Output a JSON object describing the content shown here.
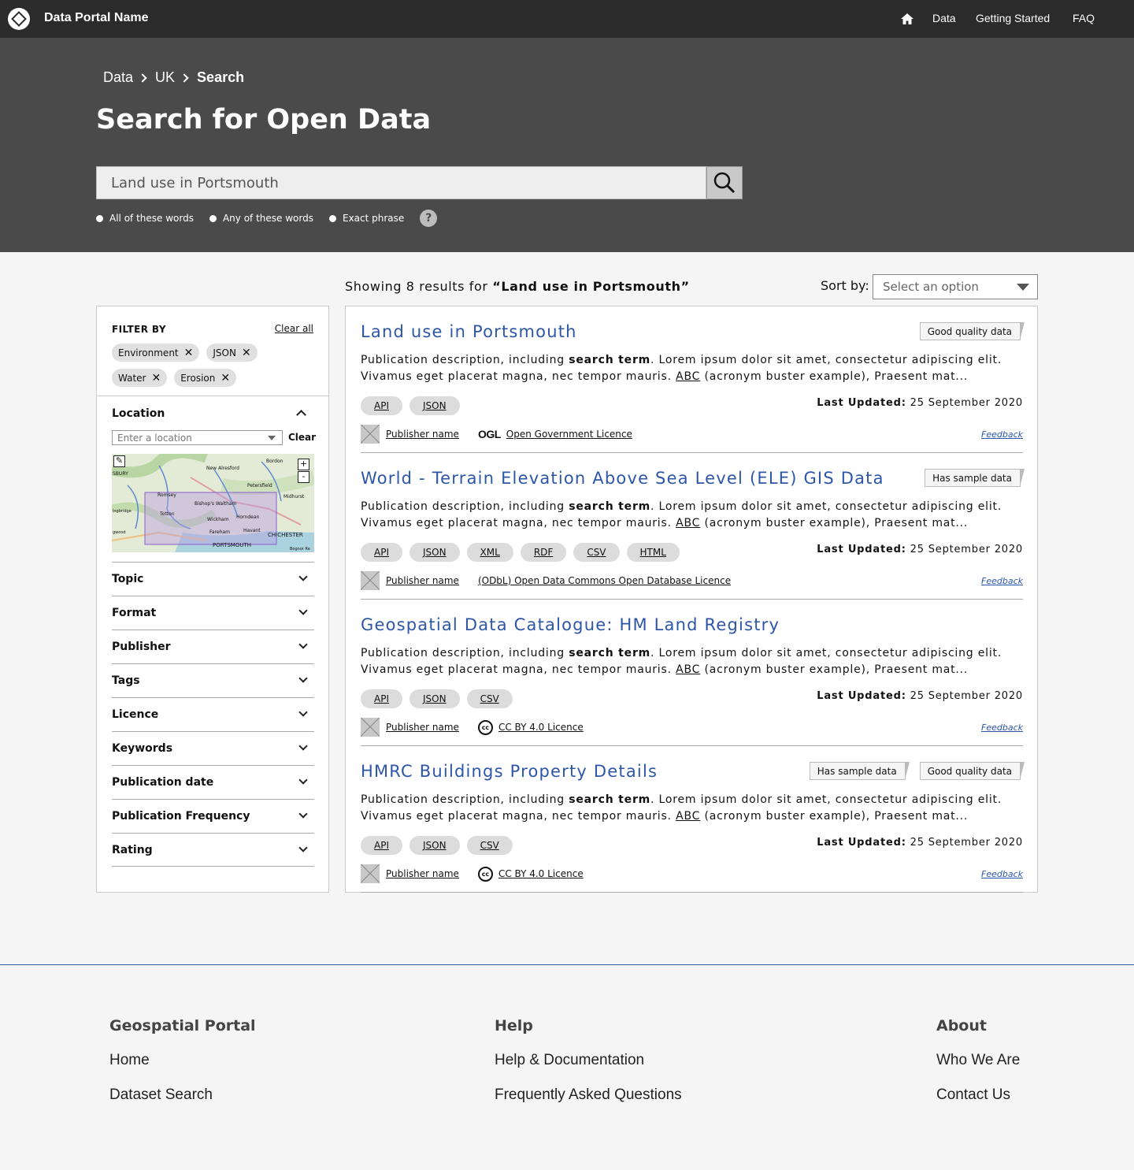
{
  "nav": {
    "portal_name": "Data Portal Name",
    "links": [
      "Data",
      "Getting Started",
      "FAQ"
    ]
  },
  "hero": {
    "breadcrumb": [
      "Data",
      "UK",
      "Search"
    ],
    "title": "Search for Open Data",
    "search_value": "Land use in Portsmouth",
    "options": [
      "All of these words",
      "Any of these words",
      "Exact phrase"
    ],
    "help": "?"
  },
  "results_header": {
    "prefix": "Showing 8 results for ",
    "query": "“Land use in Portsmouth”",
    "sort_label": "Sort by:",
    "sort_placeholder": "Select an option"
  },
  "filters": {
    "title": "FILTER BY",
    "clear_all": "Clear all",
    "chips": [
      "Environment",
      "JSON",
      "Water",
      "Erosion"
    ],
    "location": {
      "label": "Location",
      "placeholder": "Enter a location",
      "clear": "Clear",
      "map_labels": [
        "Bordon",
        "New Alresford",
        "SBURY",
        "Romsey",
        "Bishop's Waltham",
        "Petersfield",
        "Midhurst",
        "Totton",
        "Wickham",
        "Horndean",
        "Fareham",
        "Havant",
        "CHICHESTER",
        "PORTSMOUTH",
        "Bognor Re",
        "ingbridge",
        "gwood"
      ]
    },
    "sections": [
      "Topic",
      "Format",
      "Publisher",
      "Tags",
      "Licence",
      "Keywords",
      "Publication date",
      "Publication Frequency",
      "Rating"
    ]
  },
  "results": [
    {
      "title": "Land use in Portsmouth",
      "badges": [
        "Good quality data"
      ],
      "desc_a": "Publication description, including ",
      "desc_b": "search term",
      "desc_c": ". Lorem ipsum dolor sit amet, consectetur adipiscing elit. Vivamus eget placerat magna, nec tempor mauris. ",
      "desc_abbr": "ABC",
      "desc_d": " (acronym buster example), Praesent mat...",
      "formats": [
        "API",
        "JSON"
      ],
      "updated_label": "Last Updated:",
      "updated_value": "25 September 2020",
      "publisher": "Publisher name",
      "licence_icon": "OGL",
      "licence": "Open Government Licence",
      "feedback": "Feedback"
    },
    {
      "title": "World - Terrain Elevation Above Sea Level (ELE) GIS Data",
      "badges": [
        "Has sample data"
      ],
      "desc_a": "Publication description, including ",
      "desc_b": "search term",
      "desc_c": ". Lorem ipsum dolor sit amet, consectetur adipiscing elit. Vivamus eget placerat magna, nec tempor mauris. ",
      "desc_abbr": "ABC",
      "desc_d": " (acronym buster example), Praesent mat...",
      "formats": [
        "API",
        "JSON",
        "XML",
        "RDF",
        "CSV",
        "HTML"
      ],
      "updated_label": "Last Updated:",
      "updated_value": "25 September 2020",
      "publisher": "Publisher name",
      "licence_icon": "",
      "licence": "(ODbL) Open Data Commons Open Database Licence",
      "feedback": "Feedback"
    },
    {
      "title": "Geospatial Data Catalogue: HM Land Registry",
      "badges": [],
      "desc_a": "Publication description, including ",
      "desc_b": "search term",
      "desc_c": ". Lorem ipsum dolor sit amet, consectetur adipiscing elit. Vivamus eget placerat magna, nec tempor mauris. ",
      "desc_abbr": "ABC",
      "desc_d": " (acronym buster example), Praesent mat...",
      "formats": [
        "API",
        "JSON",
        "CSV"
      ],
      "updated_label": "Last Updated:",
      "updated_value": "25 September 2020",
      "publisher": "Publisher name",
      "licence_icon": "cc",
      "licence": "CC BY 4.0 Licence",
      "feedback": "Feedback"
    },
    {
      "title": "HMRC Buildings Property Details",
      "badges": [
        "Has sample data",
        "Good quality data"
      ],
      "desc_a": "Publication description, including ",
      "desc_b": "search term",
      "desc_c": ". Lorem ipsum dolor sit amet, consectetur adipiscing elit. Vivamus eget placerat magna, nec tempor mauris. ",
      "desc_abbr": "ABC",
      "desc_d": " (acronym buster example), Praesent mat...",
      "formats": [
        "API",
        "JSON",
        "CSV"
      ],
      "updated_label": "Last Updated:",
      "updated_value": "25 September 2020",
      "publisher": "Publisher name",
      "licence_icon": "cc",
      "licence": "CC BY 4.0 Licence",
      "feedback": "Feedback"
    }
  ],
  "footer": {
    "columns": [
      {
        "title": "Geospatial Portal",
        "links": [
          "Home",
          "Dataset Search"
        ]
      },
      {
        "title": "Help",
        "links": [
          "Help & Documentation",
          "Frequently Asked Questions"
        ]
      },
      {
        "title": "About",
        "links": [
          "Who We Are",
          "Contact Us"
        ]
      }
    ]
  },
  "colors": {
    "nav_bg": "#2b2b2b",
    "hero_bg": "#4a4a4a",
    "link_blue": "#2d56a8"
  }
}
